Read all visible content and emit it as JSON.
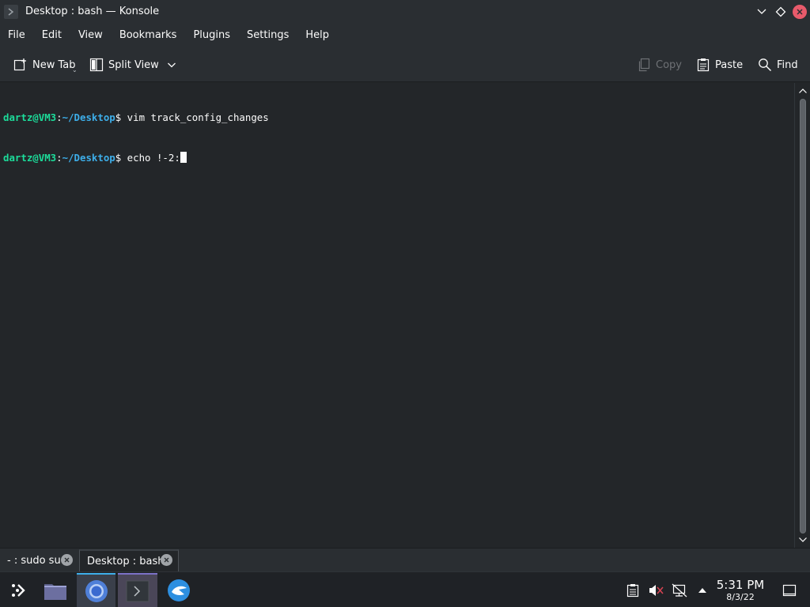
{
  "window": {
    "title": "Desktop : bash — Konsole",
    "icon": "konsole-icon",
    "controls": [
      "minimize-icon",
      "maximize-icon",
      "close-icon"
    ]
  },
  "menu": [
    "File",
    "Edit",
    "View",
    "Bookmarks",
    "Plugins",
    "Settings",
    "Help"
  ],
  "toolbar": {
    "new_tab": "New Tab",
    "split_view": "Split View",
    "copy": "Copy",
    "paste": "Paste",
    "find": "Find"
  },
  "terminal": {
    "lines": [
      {
        "user_host": "dartz@VM3",
        "colon": ":",
        "path": "~/Desktop",
        "dollar": "$",
        "command": " vim track_config_changes"
      },
      {
        "user_host": "dartz@VM3",
        "colon": ":",
        "path": "~/Desktop",
        "dollar": "$",
        "command": " echo !-2:"
      }
    ]
  },
  "tabs": [
    {
      "label": "- : sudo su",
      "active": false
    },
    {
      "label": "Desktop : bash",
      "active": true
    }
  ],
  "taskbar": {
    "apps": [
      "application-launcher-icon",
      "file-manager-icon",
      "chromium-icon",
      "konsole-icon",
      "discover-icon"
    ],
    "tray": [
      "clipboard-icon",
      "volume-muted-icon",
      "network-icon",
      "show-hidden-icons-icon"
    ],
    "clock": {
      "time": "5:31 PM",
      "date": "8/3/22"
    }
  },
  "colors": {
    "background": "#232629",
    "prompt_user": "#1cdc9a",
    "prompt_path": "#3daee9",
    "close_button": "#e85a6b"
  }
}
